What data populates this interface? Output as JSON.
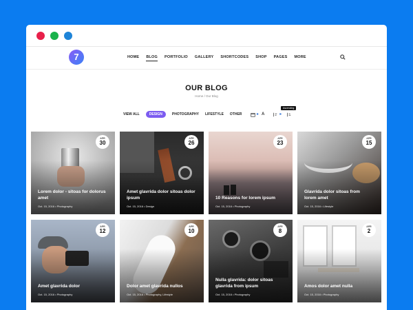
{
  "window": {
    "dots": [
      "#e8204a",
      "#19b24b",
      "#1e84d8"
    ]
  },
  "nav": {
    "logo": "7",
    "items": [
      "HOME",
      "BLOG",
      "PORTFOLIO",
      "GALLERY",
      "SHORTCODES",
      "SHOP",
      "PAGES",
      "MORE"
    ],
    "active": "BLOG"
  },
  "page": {
    "title": "OUR BLOG",
    "breadcrumb": "Home / Our Blog"
  },
  "filters": [
    "VIEW ALL",
    "DESIGN",
    "PHOTOGRAPHY",
    "LIFESTYLE",
    "OTHER"
  ],
  "sort": {
    "tooltip": "Ascending",
    "tool_a": "A"
  },
  "posts": [
    {
      "month": "APR",
      "day": "30",
      "title": "Lorem dolor - sitoas for dolorus amet",
      "date": "Oct. 15, 2016",
      "category": "Photography"
    },
    {
      "month": "APR",
      "day": "26",
      "title": "Amet glavrida dolor sitoas dolor ipsum",
      "date": "Oct. 15, 2016",
      "category": "Design"
    },
    {
      "month": "APR",
      "day": "23",
      "title": "10 Reasons for lorem ipsum",
      "date": "Oct. 15, 2016",
      "category": "Photography"
    },
    {
      "month": "APR",
      "day": "15",
      "title": "Glavrida dolor sitoas from lorem amet",
      "date": "Oct. 15, 2016",
      "category": "Lifestyle"
    },
    {
      "month": "APR",
      "day": "12",
      "title": "Amet glavrida dolor",
      "date": "Oct. 15, 2016",
      "category": "Photography"
    },
    {
      "month": "APR",
      "day": "10",
      "title": "Dolor amet glavrida nullos",
      "date": "Oct. 15, 2016",
      "category": "Photography, Lifestyle"
    },
    {
      "month": "APR",
      "day": "8",
      "title": "Nulla glavrida: dolor sitoas glavrida from ipsum",
      "date": "Oct. 15, 2016",
      "category": "Photography"
    },
    {
      "month": "APR",
      "day": "2",
      "title": "Amos dolor amet nulla",
      "date": "Oct. 15, 2016",
      "category": "Photography"
    }
  ]
}
